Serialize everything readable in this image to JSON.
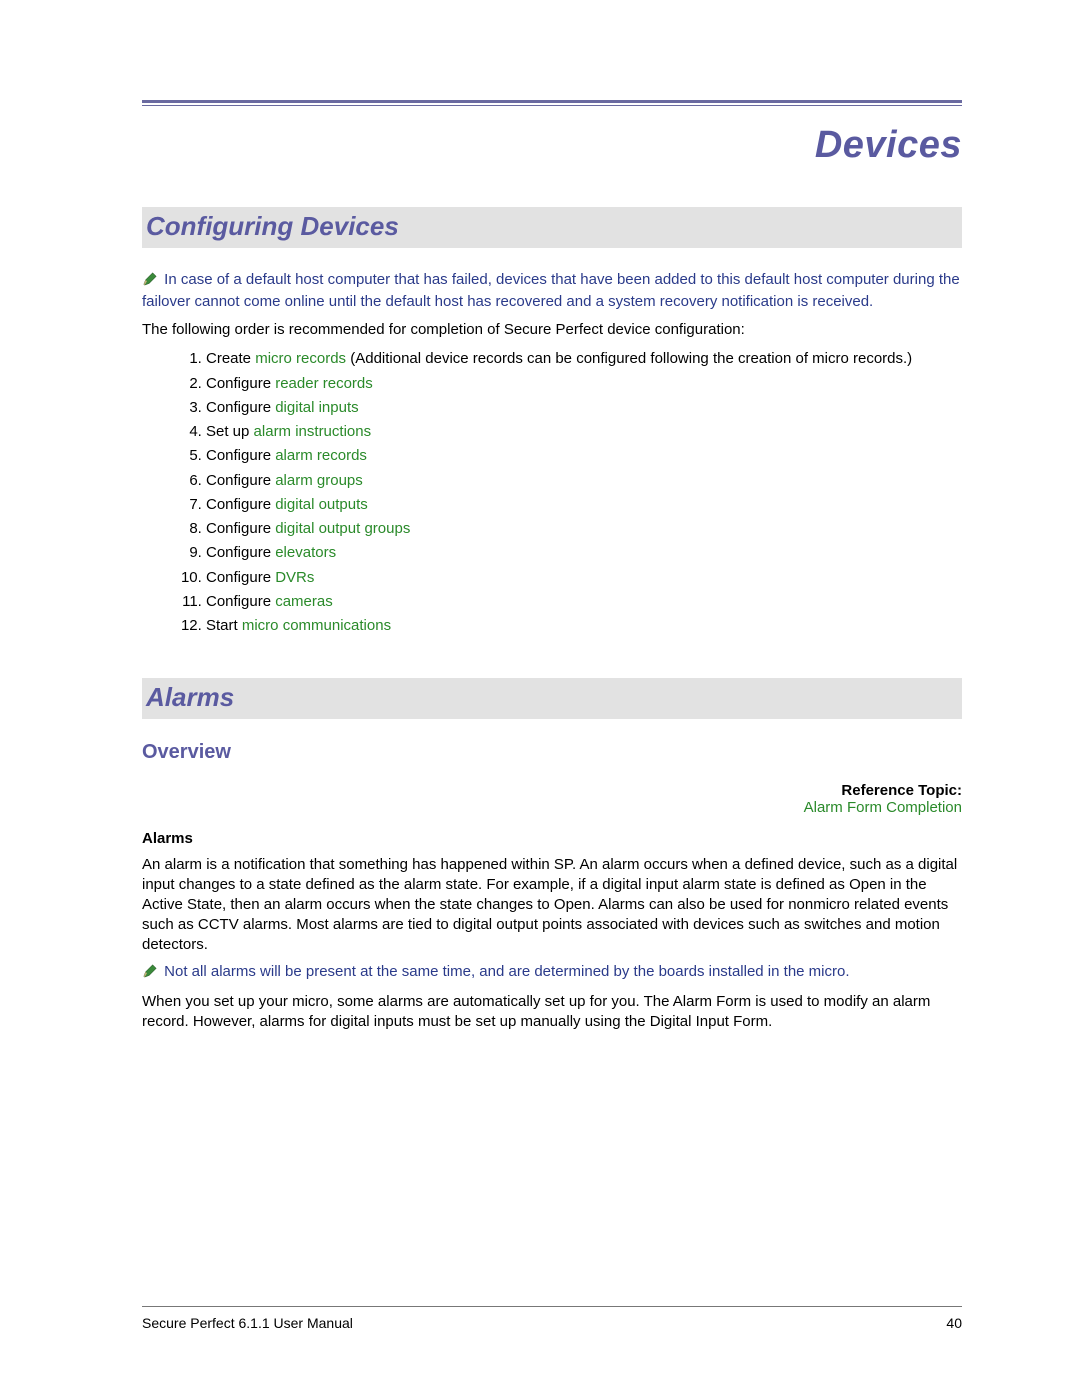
{
  "chapter": {
    "title": "Devices"
  },
  "section1": {
    "title": "Configuring Devices",
    "note": "In case of a default host computer that has failed, devices that have been added to this default host computer during the failover cannot come online until the default host has recovered and a system recovery notification is received.",
    "intro": "The following order is recommended for completion of Secure Perfect device configuration:",
    "steps": [
      {
        "pre": "Create ",
        "link": "micro records",
        "post": " (Additional device records can be configured following the creation of micro records.)"
      },
      {
        "pre": "Configure ",
        "link": "reader records",
        "post": ""
      },
      {
        "pre": "Configure ",
        "link": "digital inputs",
        "post": ""
      },
      {
        "pre": "Set up ",
        "link": "alarm instructions",
        "post": ""
      },
      {
        "pre": "Configure ",
        "link": "alarm records",
        "post": ""
      },
      {
        "pre": "Configure ",
        "link": "alarm groups",
        "post": ""
      },
      {
        "pre": "Configure ",
        "link": "digital outputs",
        "post": ""
      },
      {
        "pre": "Configure ",
        "link": "digital output groups",
        "post": ""
      },
      {
        "pre": "Configure ",
        "link": "elevators",
        "post": ""
      },
      {
        "pre": "Configure ",
        "link": "DVRs",
        "post": ""
      },
      {
        "pre": "Configure ",
        "link": "cameras",
        "post": ""
      },
      {
        "pre": "Start ",
        "link": "micro communications",
        "post": ""
      }
    ]
  },
  "section2": {
    "title": "Alarms",
    "subheading": "Overview",
    "ref_label": "Reference Topic:",
    "ref_link": "Alarm Form Completion",
    "sub_bold": "Alarms",
    "para1": "An alarm is a notification that something has happened within SP. An alarm occurs when a defined device, such as a digital input changes to a state defined as the alarm state. For example, if a digital input alarm state is defined as Open in the Active State, then an alarm occurs when the state changes to Open. Alarms can also be used for nonmicro related events such as CCTV alarms. Most alarms are tied to digital output points associated with devices such as switches and motion detectors.",
    "note": "Not all alarms will be present at the same time, and are determined by the boards installed in the micro.",
    "para2": "When you set up your micro, some alarms are automatically set up for you. The Alarm Form is used to modify an alarm record. However, alarms for digital inputs must be set up manually using the Digital Input Form."
  },
  "footer": {
    "left": "Secure Perfect 6.1.1 User Manual",
    "right": "40"
  }
}
